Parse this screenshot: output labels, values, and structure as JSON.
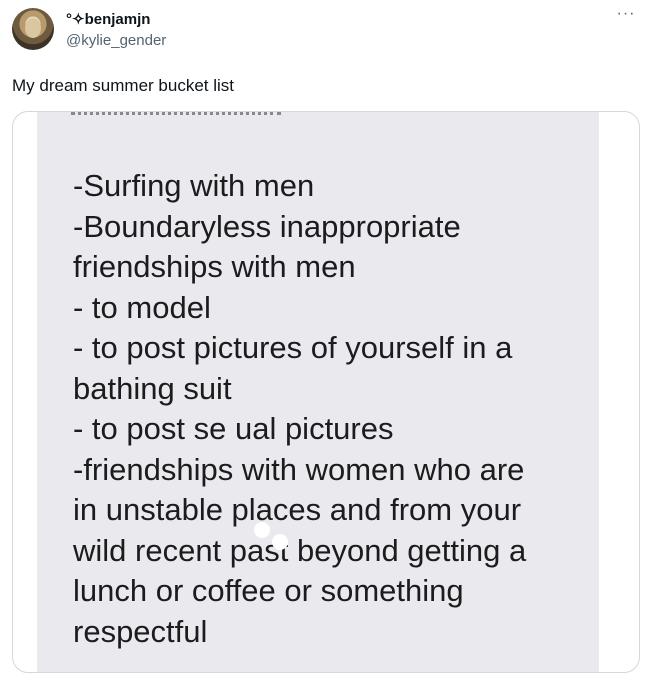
{
  "tweet": {
    "author": {
      "display_name": "°✧benjamjn",
      "handle": "@kylie_gender"
    },
    "more_label": "···",
    "text": "My dream summer bucket list"
  },
  "media": {
    "lines": [
      "-Surfing with men",
      "-Boundaryless inappropriate",
      "friendships with men",
      "- to model",
      "- to post pictures of yourself in a",
      "bathing suit",
      "- to post se ual pictures",
      "-friendships with women who are",
      "in unstable places and from your",
      "wild recent past beyond getting a",
      "lunch or coffee or something",
      "respectful"
    ]
  }
}
